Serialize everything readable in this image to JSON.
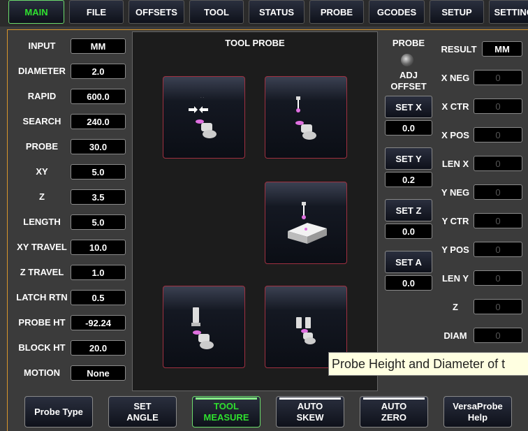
{
  "tabs": [
    "MAIN",
    "FILE",
    "OFFSETS",
    "TOOL",
    "STATUS",
    "PROBE",
    "GCODES",
    "SETUP",
    "SETTINGS"
  ],
  "left_params": [
    {
      "label": "INPUT",
      "value": "MM"
    },
    {
      "label": "DIAMETER",
      "value": "2.0"
    },
    {
      "label": "RAPID",
      "value": "600.0"
    },
    {
      "label": "SEARCH",
      "value": "240.0"
    },
    {
      "label": "PROBE",
      "value": "30.0"
    },
    {
      "label": "XY",
      "value": "5.0"
    },
    {
      "label": "Z",
      "value": "3.5"
    },
    {
      "label": "LENGTH",
      "value": "5.0"
    },
    {
      "label": "XY TRAVEL",
      "value": "10.0"
    },
    {
      "label": "Z TRAVEL",
      "value": "1.0"
    },
    {
      "label": "LATCH RTN",
      "value": "0.5"
    },
    {
      "label": "PROBE HT",
      "value": "-92.24"
    },
    {
      "label": "BLOCK HT",
      "value": "20.0"
    },
    {
      "label": "MOTION",
      "value": "None"
    }
  ],
  "tool_probe": {
    "title": "TOOL PROBE"
  },
  "probe_led_label": "PROBE",
  "adj_offset": {
    "line1": "ADJ",
    "line2": "OFFSET"
  },
  "set_buttons": [
    {
      "label": "SET  X",
      "value": "0.0"
    },
    {
      "label": "SET  Y",
      "value": "0.2"
    },
    {
      "label": "SET  Z",
      "value": "0.0"
    },
    {
      "label": "SET  A",
      "value": "0.0"
    }
  ],
  "result": {
    "label": "RESULT",
    "value": "MM"
  },
  "results": [
    {
      "label": "X NEG",
      "value": "0"
    },
    {
      "label": "X CTR",
      "value": "0"
    },
    {
      "label": "X POS",
      "value": "0"
    },
    {
      "label": "LEN X",
      "value": "0"
    },
    {
      "label": "Y NEG",
      "value": "0"
    },
    {
      "label": "Y CTR",
      "value": "0"
    },
    {
      "label": "Y POS",
      "value": "0"
    },
    {
      "label": "LEN Y",
      "value": "0"
    },
    {
      "label": "Z",
      "value": "0"
    },
    {
      "label": "DIAM",
      "value": "0"
    }
  ],
  "bottom_buttons": [
    {
      "line1": "Probe Type",
      "line2": ""
    },
    {
      "line1": "SET",
      "line2": "ANGLE"
    },
    {
      "line1": "TOOL",
      "line2": "MEASURE"
    },
    {
      "line1": "AUTO",
      "line2": "SKEW"
    },
    {
      "line1": "AUTO",
      "line2": "ZERO"
    },
    {
      "line1": "VersaProbe",
      "line2": "Help"
    }
  ],
  "tooltip": "Probe Height and Diameter of t",
  "colors": {
    "active_green": "#2fe02f",
    "frame_orange": "#d9962c",
    "probe_border": "#a03040"
  }
}
